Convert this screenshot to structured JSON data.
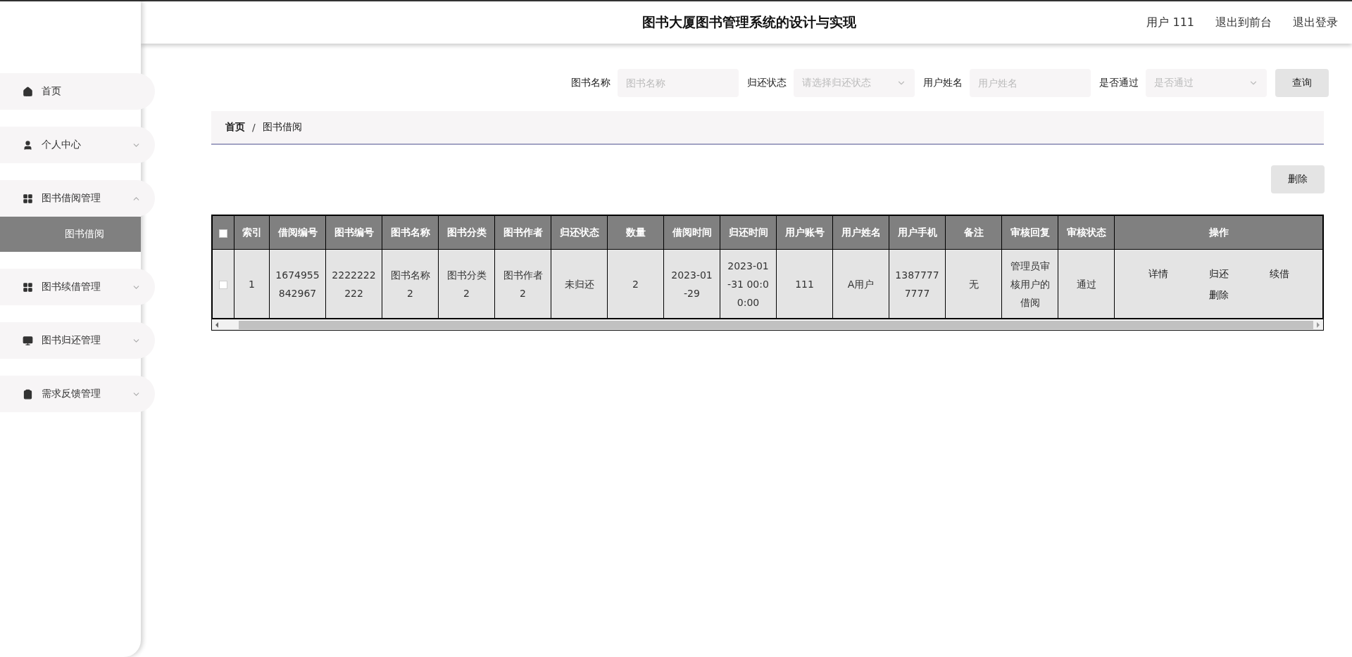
{
  "header": {
    "title": "图书大厦图书管理系统的设计与实现",
    "links": [
      "用户 111",
      "退出到前台",
      "退出登录"
    ]
  },
  "sidebar": {
    "items": [
      {
        "label": "首页",
        "kind": "home"
      },
      {
        "label": "个人中心",
        "kind": "user",
        "expanded": false
      },
      {
        "label": "图书借阅管理",
        "kind": "grid",
        "expanded": true,
        "children": [
          {
            "label": "图书借阅",
            "selected": true
          }
        ]
      },
      {
        "label": "图书续借管理",
        "kind": "grid",
        "expanded": false
      },
      {
        "label": "图书归还管理",
        "kind": "monitor",
        "expanded": false
      },
      {
        "label": "需求反馈管理",
        "kind": "clipboard",
        "expanded": false
      }
    ]
  },
  "search": {
    "fields": [
      {
        "kind": "input",
        "label": "图书名称",
        "placeholder": "图书名称"
      },
      {
        "kind": "select",
        "label": "归还状态",
        "placeholder": "请选择归还状态"
      },
      {
        "kind": "input",
        "label": "用户姓名",
        "placeholder": "用户姓名"
      },
      {
        "kind": "select",
        "label": "是否通过",
        "placeholder": "是否通过"
      }
    ],
    "button": "查询"
  },
  "breadcrumb": {
    "items": [
      "首页",
      "图书借阅"
    ],
    "separator": "/"
  },
  "delete_button": "删除",
  "table": {
    "all_checked": false,
    "columns": [
      "索引",
      "借阅编号",
      "图书编号",
      "图书名称",
      "图书分类",
      "图书作者",
      "归还状态",
      "数量",
      "借阅时间",
      "归还时间",
      "用户账号",
      "用户姓名",
      "用户手机",
      "备注",
      "审核回复",
      "审核状态",
      "操作"
    ],
    "rows": [
      {
        "checked": false,
        "cells": [
          "1",
          "1674955842967",
          "2222222222",
          "图书名称2",
          "图书分类2",
          "图书作者2",
          "未归还",
          "2",
          "2023-01-29",
          "2023-01-31 00:00:00",
          "111",
          "A用户",
          "13877777777",
          "无",
          "管理员审核用户的借阅",
          "通过"
        ],
        "actions": [
          "详情",
          "归还",
          "续借",
          "删除"
        ]
      }
    ]
  }
}
